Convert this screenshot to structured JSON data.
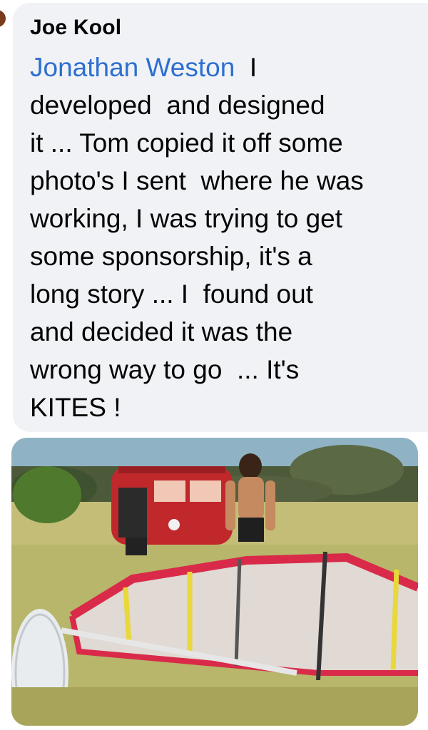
{
  "comment": {
    "author": "Joe Kool",
    "mention": "Jonathan Weston",
    "lines": [
      "  I",
      "developed  and designed",
      "it ... Tom copied it off some",
      "photo's I sent  where he was",
      "working, I was trying to get",
      "some sponsorship, it's a",
      "long story ... I  found out",
      "and decided it was the",
      "wrong way to go  ... It's",
      "KITES !"
    ]
  },
  "photo": {
    "description_icon": "photo-attachment",
    "colors": {
      "sky": "#8fb3c4",
      "grass": "#c9c27a",
      "van": "#c0282c",
      "sail_frame": "#d92a4a",
      "batten": "#e8d83a"
    }
  }
}
